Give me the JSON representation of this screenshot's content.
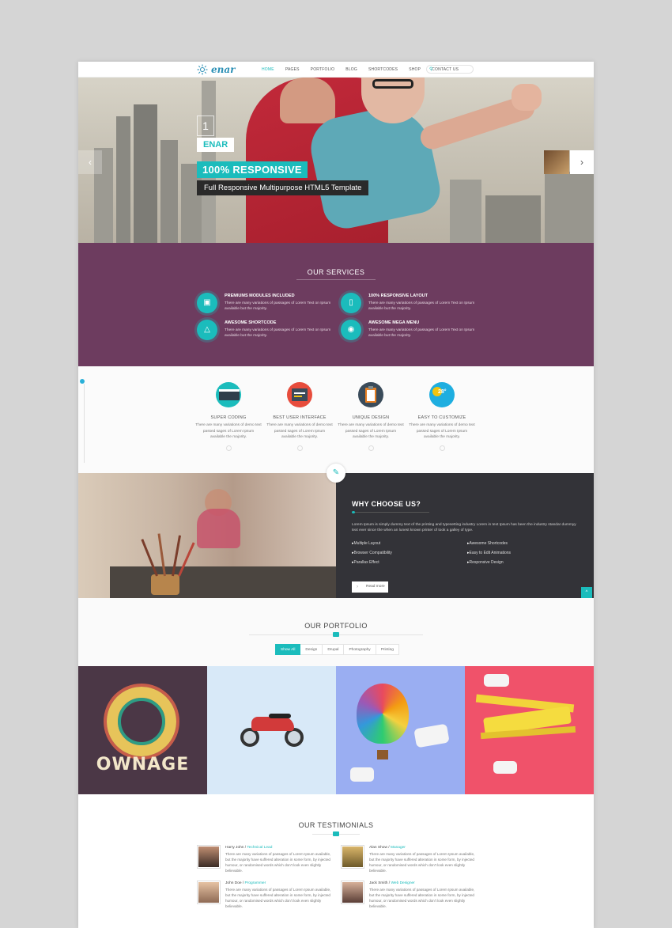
{
  "header": {
    "logo_text": "enar",
    "nav": [
      "HOME",
      "PAGES",
      "PORTFOLIO",
      "BLOG",
      "SHORTCODES",
      "SHOP",
      "CONTACT US"
    ]
  },
  "hero": {
    "slide_number": "1",
    "name": "ENAR",
    "tagline": "100% RESPONSIVE",
    "subtitle": "Full Responsive Multipurpose HTML5 Template",
    "prev_arrow": "‹",
    "next_arrow": "›"
  },
  "services": {
    "title": "OUR SERVICES",
    "items": [
      {
        "title": "PREMIUMS MODULES INCLUDED",
        "text": "There are many variations of passages of Lorem Text on Ipsum available but the majority.",
        "icon": "monitor-icon"
      },
      {
        "title": "100% RESPONSIVE LAYOUT",
        "text": "There are many variations of passages of Lorem Text on Ipsum available but the majority.",
        "icon": "tablet-icon"
      },
      {
        "title": "AWESOME SHORTCODE",
        "text": "There are many variations of passages of Lorem Text on Ipsum available but the majority.",
        "icon": "flask-icon"
      },
      {
        "title": "AWESOME MEGA MENU",
        "text": "There are many variations of passages of Lorem Text on Ipsum available but the majority.",
        "icon": "globe-icon"
      }
    ]
  },
  "features": {
    "items": [
      {
        "title": "SUPER CODING",
        "text": "There are many variations of demo text passed sages of Lorem Ipsum available the majority.",
        "icon": "code-window-icon"
      },
      {
        "title": "BEST USER INTERFACE",
        "text": "There are many variations of demo text passed sages of Lorem Ipsum available the majority.",
        "icon": "ui-window-icon"
      },
      {
        "title": "UNIQUE DESIGN",
        "text": "There are many variations of demo text passed sages of Lorem Ipsum available the majority.",
        "icon": "clipboard-icon"
      },
      {
        "title": "EASY TO CUSTOMIZE",
        "text": "There are many variations of demo text passed sages of Lorem Ipsum available the majority.",
        "icon": "weather-icon",
        "badge": "28°"
      }
    ]
  },
  "why": {
    "title": "WHY CHOOSE US?",
    "text": "Lorem Ipsum is simply dummy text of the printing and typesetting industry Lorem in text Ipsum has been the industry standar dummyy text ever since the when an lunest known printer of took a galley of type.",
    "list_left": [
      "Multiple Layout",
      "Browser Compatibility",
      "Parallax Effect"
    ],
    "list_right": [
      "Awesome Shortcodes",
      "Easy to Edit Animations",
      "Responsive Design"
    ],
    "button": "Read more",
    "top_arrow": "^"
  },
  "portfolio": {
    "title": "OUR PORTFOLIO",
    "filters": [
      "Show All",
      "Design",
      "Drupal",
      "Photography",
      "Printing"
    ],
    "active_filter": 0,
    "ownage_text": "OWNAGE"
  },
  "testimonials": {
    "title": "OUR TESTIMONIALS",
    "items": [
      {
        "name": "Harry John /",
        "role": "Technical Lead",
        "text": "There are many variations of passages of Lorem Ipsum available, but the majority have suffered alteration in some form, by injected humour, or randomised words which don't look even slightly believable."
      },
      {
        "name": "Alan Show /",
        "role": "Manager",
        "text": "There are many variations of passages of Lorem Ipsum available, but the majority have suffered alteration in some form, by injected humour, or randomised words which don't look even slightly believable."
      },
      {
        "name": "John Doe /",
        "role": "Programmer",
        "text": "There are many variations of passages of Lorem Ipsum available, but the majority have suffered alteration in some form, by injected humour, or randomised words which don't look even slightly believable."
      },
      {
        "name": "Jack Smith /",
        "role": "Web Designer",
        "text": "There are many variations of passages of Lorem Ipsum available, but the majority have suffered alteration in some form, by injected humour, or randomised words which don't look even slightly believable."
      }
    ]
  },
  "colors": {
    "accent": "#1bbcbc",
    "services_bg": "#6d3c5f",
    "why_bg": "#333338"
  }
}
